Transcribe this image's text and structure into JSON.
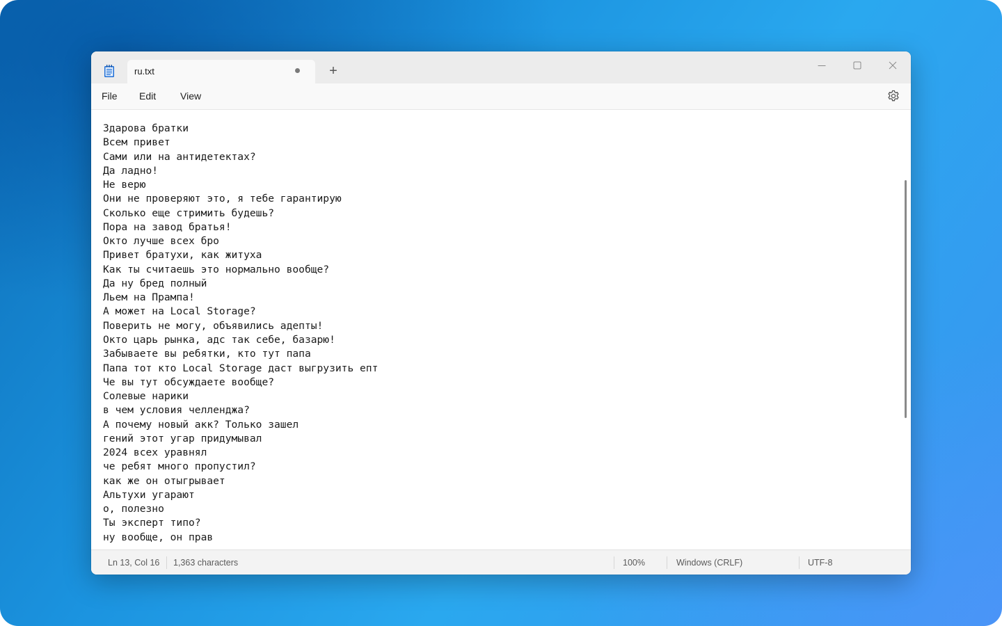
{
  "window": {
    "tab_title": "ru.txt",
    "new_tab_symbol": "+"
  },
  "menu": {
    "file": "File",
    "edit": "Edit",
    "view": "View"
  },
  "editor": {
    "lines": [
      "Здарова братки",
      "Всем привет",
      "Сами или на антидетектах?",
      "Да ладно!",
      "Не верю",
      "Они не проверяют это, я тебе гарантирую",
      "Сколько еще стримить будешь?",
      "Пора на завод братья!",
      "Окто лучше всех бро",
      "Привет братухи, как житуха",
      "Как ты считаешь это нормально вообще?",
      "Да ну бред полный",
      "Льем на Прампа!",
      "А может на Local Storage?",
      "Поверить не могу, объявились адепты!",
      "Окто царь рынка, адс так себе, базарю!",
      "Забываете вы ребятки, кто тут папа",
      "Папа тот кто Local Storage даст выгрузить епт",
      "Че вы тут обсуждаете вообще?",
      "Солевые нарики",
      "в чем условия челленджа?",
      "А почему новый акк? Только зашел",
      "гений этот угар придумывал",
      "2024 всех уравнял",
      "че ребят много пропустил?",
      "как же он отыгрывает",
      "Альтухи угарают",
      "о, полезно",
      "Ты эксперт типо?",
      "ну вообще, он прав"
    ]
  },
  "status": {
    "position": "Ln 13, Col 16",
    "characters": "1,363 characters",
    "zoom": "100%",
    "line_ending": "Windows (CRLF)",
    "encoding": "UTF-8"
  },
  "colors": {
    "accent_icon": "#1f6fd6",
    "text": "#1a1a1a"
  }
}
